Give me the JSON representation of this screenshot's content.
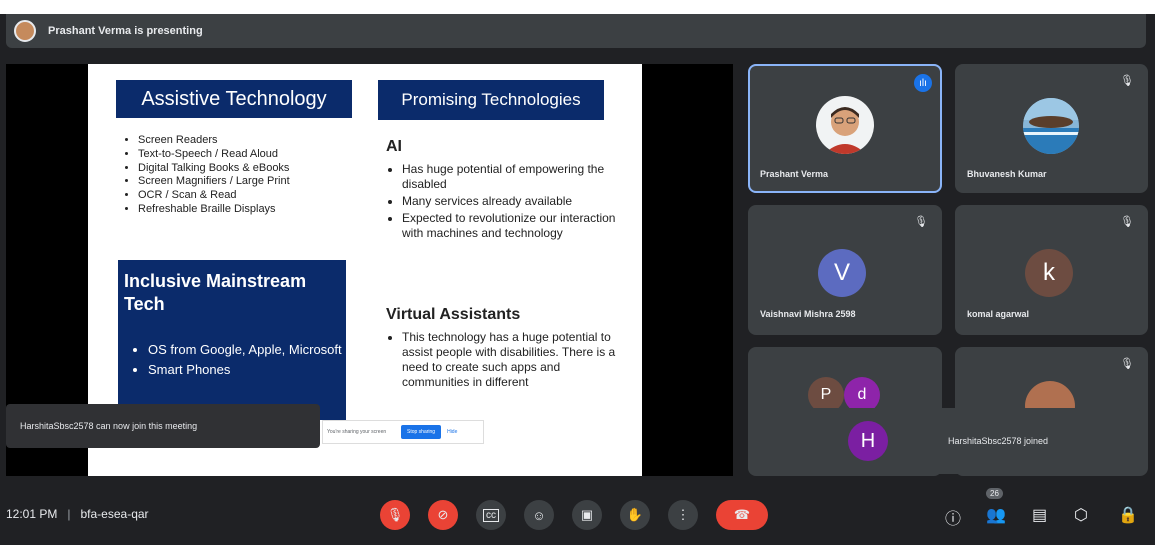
{
  "presenting": {
    "text": "Prashant Verma is presenting"
  },
  "slide": {
    "assistive": {
      "title": "Assistive Technology",
      "items": [
        "Screen Readers",
        "Text-to-Speech / Read Aloud",
        "Digital Talking Books & eBooks",
        "Screen Magnifiers / Large Print",
        "OCR / Scan & Read",
        "Refreshable Braille Displays"
      ]
    },
    "inclusive": {
      "title_line1": "Inclusive Mainstream",
      "title_line2": "Tech",
      "items": [
        "OS from Google, Apple, Microsoft",
        "Smart Phones"
      ]
    },
    "promising": {
      "title": "Promising Technologies",
      "ai_heading": "AI",
      "ai_items": [
        "Has huge potential of empowering the disabled",
        "Many services already available",
        "Expected to revolutionize our interaction with machines and technology"
      ],
      "va_heading": "Virtual Assistants",
      "va_items": [
        "This technology has a huge potential to assist people with disabilities. There is a need to create such apps and communities in different"
      ]
    },
    "share_strip": {
      "text": "You're sharing your screen",
      "stop": "Stop sharing",
      "hide": "Hide"
    }
  },
  "participants": [
    {
      "name": "Prashant Verma"
    },
    {
      "name": "Bhuvanesh Kumar"
    },
    {
      "name": "Vaishnavi Mishra 2598",
      "initial": "V",
      "color": "#5c6bc0"
    },
    {
      "name": "komal agarwal",
      "initial": "k",
      "color": "#6d4c41"
    }
  ],
  "others_tile": {
    "initial1": "P",
    "color1": "#6d4c41",
    "initial2": "d",
    "color2": "#8e24aa"
  },
  "toasts": {
    "left": "HarshitaSbsc2578 can now join this meeting",
    "right_initial": "H",
    "right_color": "#7b1fa2",
    "right": "HarshitaSbsc2578 joined"
  },
  "bottom": {
    "time": "12:01 PM",
    "meeting_code": "bfa-esea-qar",
    "participant_count": "26"
  },
  "colors": {
    "accent_blue": "#8ab4f8",
    "end_call": "#ea4335",
    "slide_title_bg": "#0b2b6b"
  }
}
